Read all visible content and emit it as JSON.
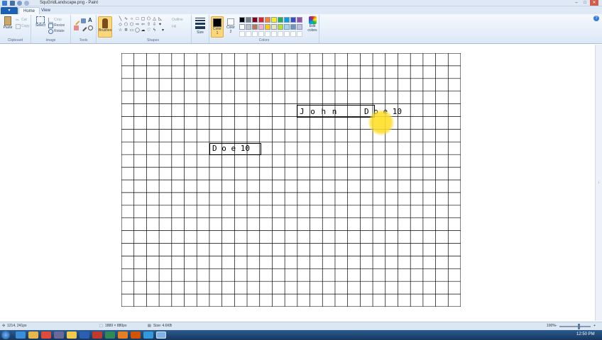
{
  "window": {
    "title": "SquGridLandscape.png - Paint",
    "controls": [
      "–",
      "□",
      "✕"
    ]
  },
  "ribbon": {
    "tabs": [
      "Home",
      "View"
    ],
    "groups": {
      "clipboard": {
        "label": "Clipboard",
        "paste": "Paste",
        "cut": "Cut",
        "copy": "Copy"
      },
      "image": {
        "label": "Image",
        "select": "Select",
        "crop": "Crop",
        "resize": "Resize",
        "rotate": "Rotate"
      },
      "tools": {
        "label": "Tools"
      },
      "brushes": {
        "label": "Brushes"
      },
      "shapes": {
        "label": "Shapes",
        "outline": "Outline",
        "fill": "Fill"
      },
      "size": {
        "label": "Size"
      },
      "colors": {
        "label": "Colors",
        "color1": "Color 1",
        "color2": "Color 2",
        "edit_colors": "Edit colors",
        "palette_row1": [
          "#000000",
          "#7f7f7f",
          "#880015",
          "#ed1c24",
          "#ff7f27",
          "#fff200",
          "#22b14c",
          "#00a2e8",
          "#3f48cc",
          "#a349a4"
        ],
        "palette_row2": [
          "#ffffff",
          "#c3c3c3",
          "#b97a57",
          "#ffaec9",
          "#ffc90e",
          "#efe4b0",
          "#b5e61d",
          "#99d9ea",
          "#7092be",
          "#c8bfe7"
        ]
      }
    }
  },
  "canvas": {
    "written_text": {
      "john": "J o h n",
      "doe_right": "D o e 10",
      "doe_left": "D o e 10"
    }
  },
  "statusbar": {
    "cursor_pos": "1214, 241px",
    "dimensions": "1889 × 880px",
    "file_size": "Size: 4.6KB",
    "zoom": "100%"
  },
  "taskbar": {
    "clock": "12:50 PM"
  }
}
